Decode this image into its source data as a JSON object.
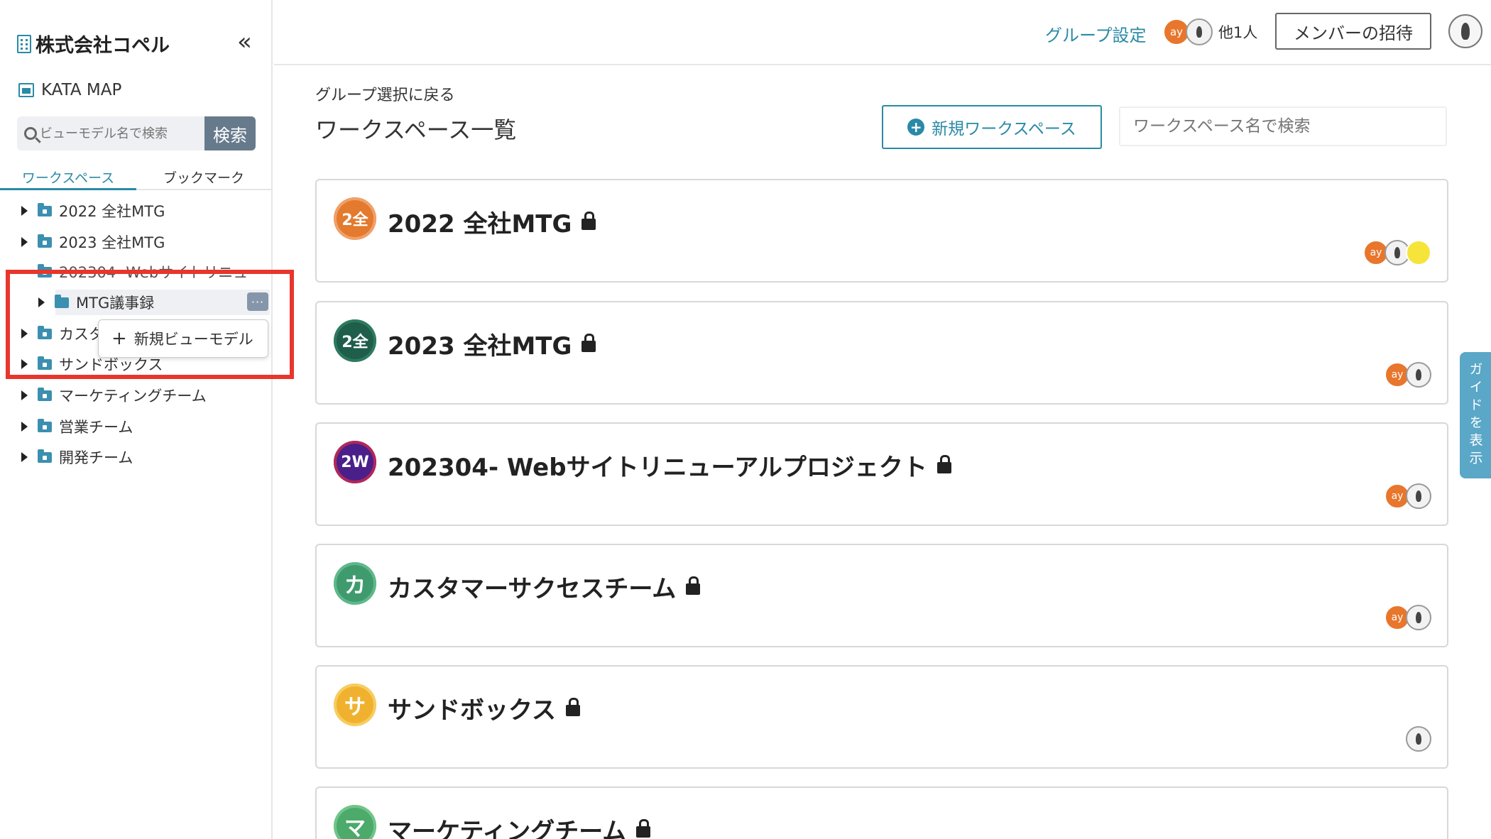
{
  "sidebar": {
    "org_name": "株式会社コペル",
    "collapse_icon": "«",
    "app_name": "KATA MAP",
    "search": {
      "placeholder": "ビューモデル名で検索",
      "button_label": "検索"
    },
    "tabs": [
      "ワークスペース",
      "ブックマーク"
    ],
    "tree": [
      {
        "label": "2022 全社MTG"
      },
      {
        "label": "2023 全社MTG"
      },
      {
        "label": "202304- Webサイトリニュ"
      },
      {
        "label": "MTG議事録"
      },
      {
        "label": "カスタ"
      },
      {
        "label": "サンドボックス"
      },
      {
        "label": "マーケティングチーム"
      },
      {
        "label": "営業チーム"
      },
      {
        "label": "開発チーム"
      }
    ],
    "more_label": "···",
    "popup_label": "新規ビューモデル",
    "popup_plus": "+"
  },
  "header": {
    "group_settings": "グループ設定",
    "avatar_ay": "ay",
    "others_label": "他1人",
    "invite_label": "メンバーの招待"
  },
  "main": {
    "back_link": "グループ選択に戻る",
    "title": "ワークスペース一覧",
    "new_workspace_label": "新規ワークスペース",
    "new_workspace_plus": "+",
    "search_placeholder": "ワークスペース名で検索",
    "workspaces": [
      {
        "badge": "2全",
        "name": "2022 全社MTG",
        "badge_color": "#e37a2d",
        "members": [
          "ay"
        ]
      },
      {
        "badge": "2全",
        "name": "2023 全社MTG",
        "badge_color": "#1f5e4a",
        "members": [
          "ay"
        ]
      },
      {
        "badge": "2W",
        "name": "202304- Webサイトリニューアルプロジェクト",
        "badge_color": "#5a1f7a",
        "members": [
          "ay"
        ]
      },
      {
        "badge": "カ",
        "name": "カスタマーサクセスチーム",
        "badge_color": "#3f9b6e",
        "members": [
          "ay"
        ]
      },
      {
        "badge": "サ",
        "name": "サンドボックス",
        "badge_color": "#f0b22e",
        "members": []
      },
      {
        "badge": "マ",
        "name": "マーケティングチーム",
        "badge_color": "#4caa6a",
        "members": []
      }
    ]
  },
  "guide_tab": "ガイドを表示"
}
